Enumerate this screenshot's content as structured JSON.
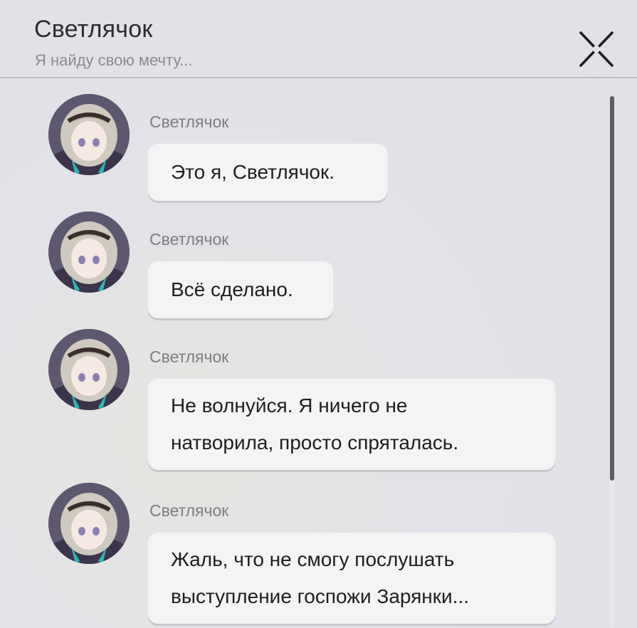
{
  "header": {
    "title": "Светлячок",
    "subtitle": "Я найду свою мечту...",
    "close_icon": "close-icon"
  },
  "messages": [
    {
      "sender": "Светлячок",
      "text": "Это я, Светлячок."
    },
    {
      "sender": "Светлячок",
      "text": "Всё сделано."
    },
    {
      "sender": "Светлячок",
      "lines": [
        "Не волнуйся. Я ничего не",
        "натворила, просто спряталась."
      ]
    },
    {
      "sender": "Светлячок",
      "lines": [
        "Жаль, что не смогу послушать",
        "выступление госпожи Зарянки..."
      ]
    }
  ],
  "colors": {
    "bubble": "#f4f4f5",
    "scroll_thumb": "#5c5d62"
  }
}
